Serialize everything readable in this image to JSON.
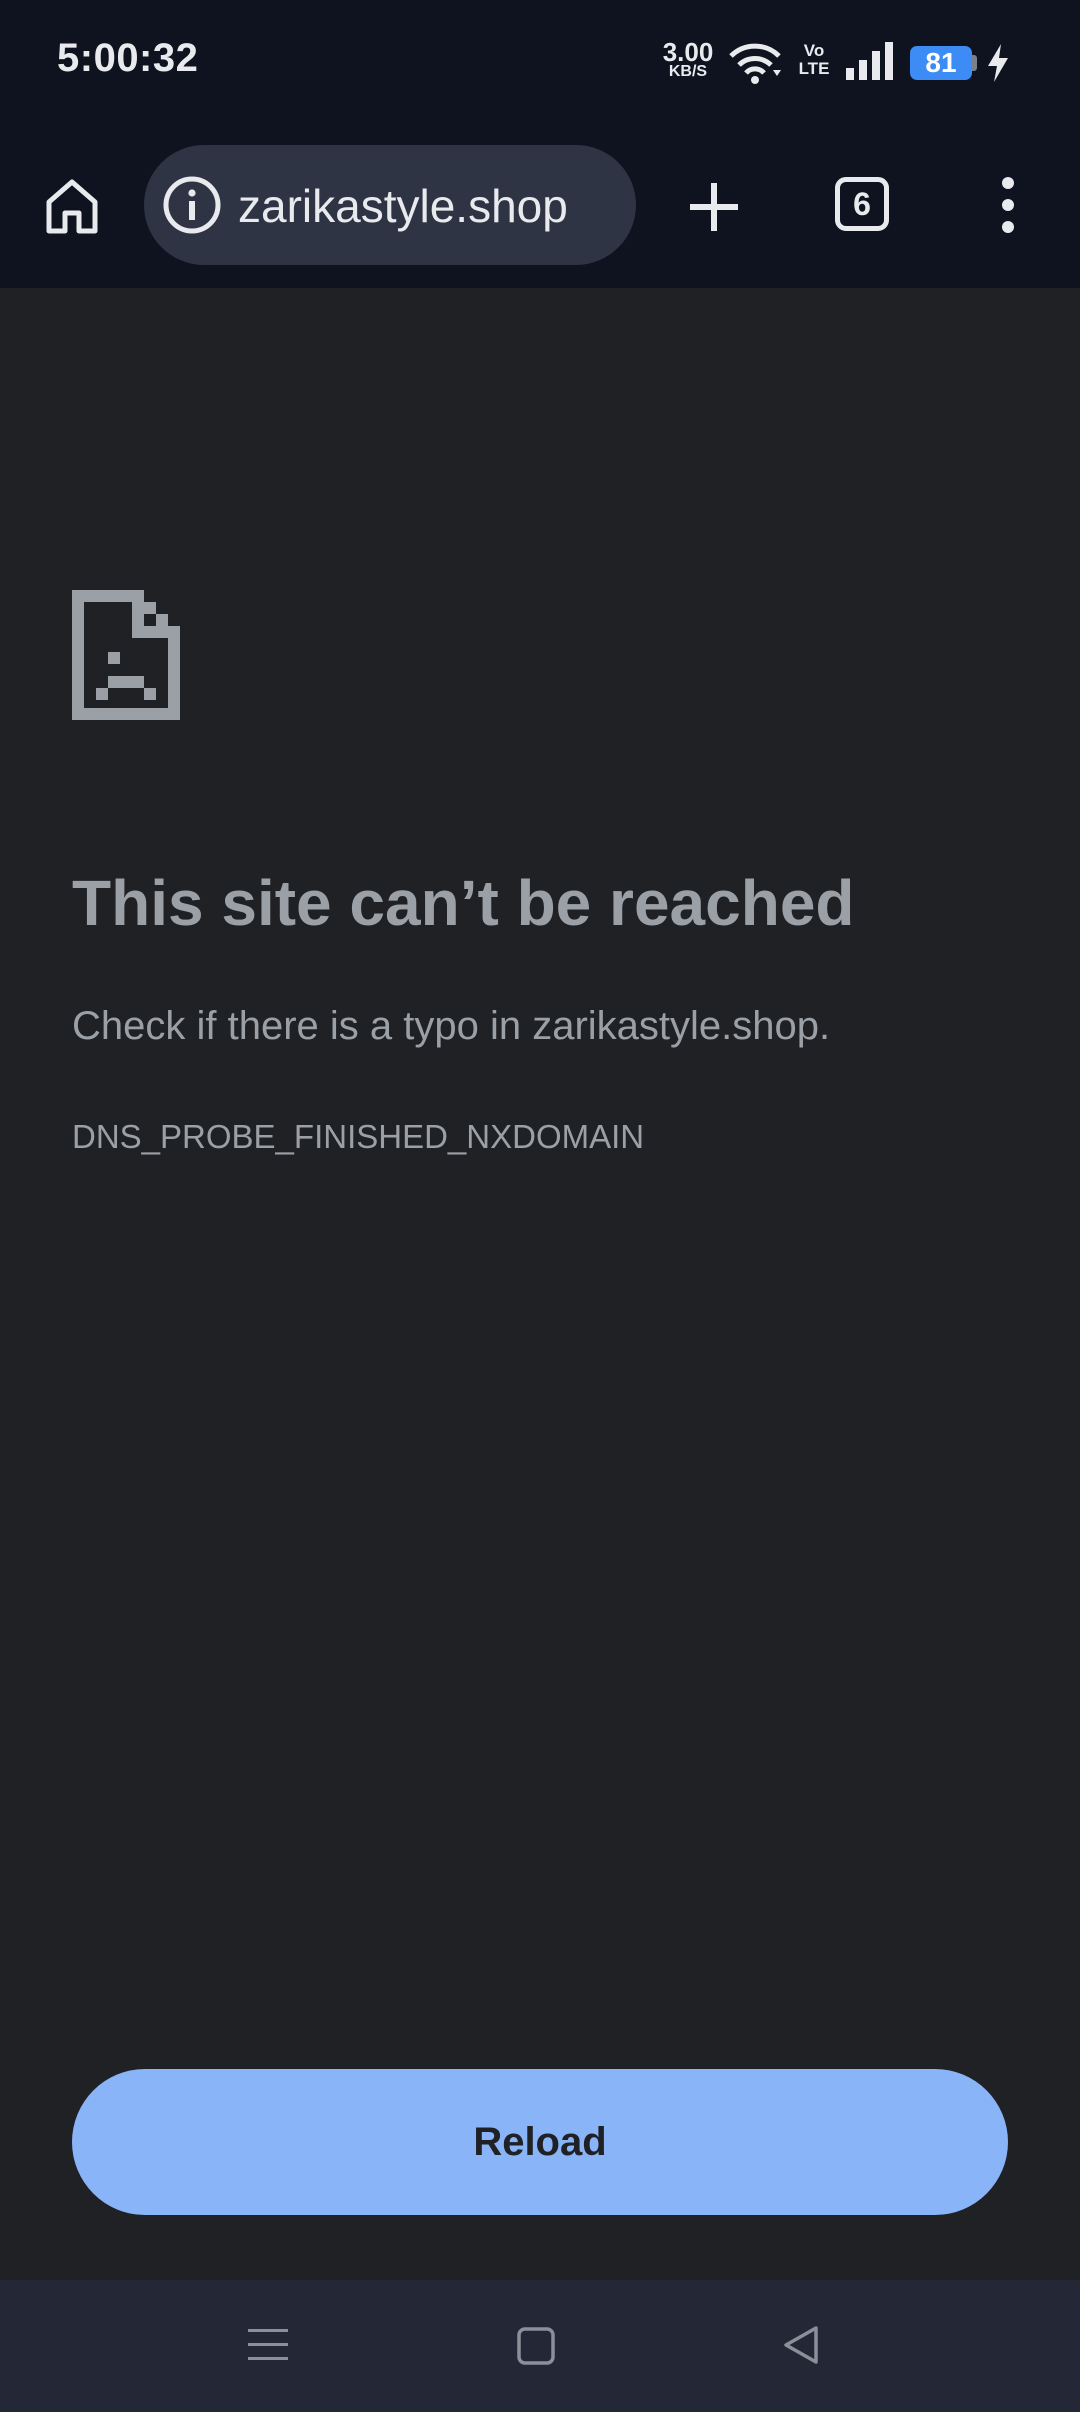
{
  "status_bar": {
    "time": "5:00:32",
    "net_speed_value": "3.00",
    "net_speed_unit": "KB/S",
    "volte_line1": "Vo",
    "volte_line2": "LTE",
    "battery_level": "81",
    "icons": [
      "wifi-icon",
      "signal-icon",
      "charging-icon"
    ],
    "battery_color": "#3d8bf5"
  },
  "toolbar": {
    "url": "zarikastyle.shop",
    "tab_count": "6",
    "icons": [
      "home-icon",
      "info-icon",
      "new-tab-icon",
      "tab-switcher-icon",
      "more-options-icon"
    ]
  },
  "error_page": {
    "icon": "sad-document-icon",
    "title": "This site can’t be reached",
    "description": "Check if there is a typo in zarikastyle.shop.",
    "error_code": "DNS_PROBE_FINISHED_NXDOMAIN",
    "reload_label": "Reload",
    "accent_color": "#8ab4f8"
  },
  "nav_bar": {
    "icons": [
      "recents-menu-icon",
      "home-square-icon",
      "back-triangle-icon"
    ]
  }
}
